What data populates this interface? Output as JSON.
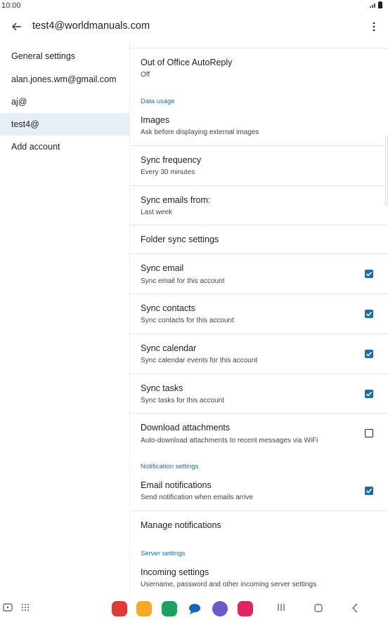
{
  "status": {
    "time": "10:00"
  },
  "header": {
    "title": "test4@worldmanuals.com"
  },
  "sidebar": {
    "items": [
      {
        "label": "General settings"
      },
      {
        "label": "alan.jones.wm@gmail.com"
      },
      {
        "label": "aj@"
      },
      {
        "label": "test4@"
      },
      {
        "label": "Add account"
      }
    ]
  },
  "settings": {
    "out_of_office": {
      "title": "Out of Office AutoReply",
      "value": "Off"
    },
    "data_usage_label": "Data usage",
    "images": {
      "title": "Images",
      "value": "Ask before displaying external images"
    },
    "sync_frequency": {
      "title": "Sync frequency",
      "value": "Every 30 minutes"
    },
    "sync_emails_from": {
      "title": "Sync emails from:",
      "value": "Last week"
    },
    "folder_sync": {
      "title": "Folder sync settings"
    },
    "sync_email": {
      "title": "Sync email",
      "value": "Sync email for this account",
      "checked": true
    },
    "sync_contacts": {
      "title": "Sync contacts",
      "value": "Sync contacts for this account",
      "checked": true
    },
    "sync_calendar": {
      "title": "Sync calendar",
      "value": "Sync calendar events for this account",
      "checked": true
    },
    "sync_tasks": {
      "title": "Sync tasks",
      "value": "Sync tasks for this account",
      "checked": true
    },
    "download_attachments": {
      "title": "Download attachments",
      "value": "Auto-download attachments to recent messages via WiFi",
      "checked": false
    },
    "notification_label": "Notification settings",
    "email_notifications": {
      "title": "Email notifications",
      "value": "Send notification when emails arrive",
      "checked": true
    },
    "manage_notifications": {
      "title": "Manage notifications"
    },
    "server_label": "Server settings",
    "incoming": {
      "title": "Incoming settings",
      "value": "Username, password and other incoming server settings"
    }
  },
  "colors": {
    "accent": "#1a6fa0",
    "selected_bg": "#e8eef8"
  },
  "dock": {
    "apps": [
      {
        "icon": "red-app-icon",
        "color": "#e53935"
      },
      {
        "icon": "folder-app-icon",
        "color": "#f9a825"
      },
      {
        "icon": "phone-app-icon",
        "color": "#1aa260"
      },
      {
        "icon": "messages-app-icon",
        "color": "#1565c0"
      },
      {
        "icon": "internet-app-icon",
        "color": "#6a5acd"
      },
      {
        "icon": "camera-app-icon",
        "color": "#e0245e"
      }
    ]
  }
}
